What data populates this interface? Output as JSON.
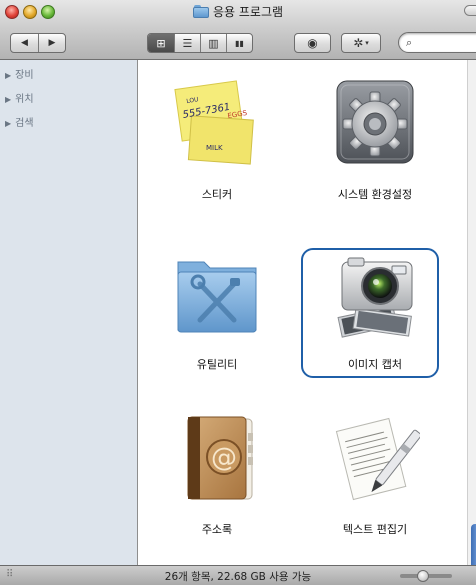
{
  "window": {
    "title": "응용 프로그램"
  },
  "toolbar": {
    "nav_back_icon": "◀",
    "nav_forward_icon": "▶",
    "view_icons": [
      "⊞",
      "☰",
      "▥",
      "▮▮"
    ],
    "quicklook_icon": "◉",
    "action_icon": "✲",
    "action_caret": "▾",
    "search_placeholder": "",
    "search_icon": "⌕"
  },
  "sidebar": {
    "items": [
      {
        "label": "장비"
      },
      {
        "label": "위치"
      },
      {
        "label": "검색"
      }
    ],
    "disclosure_icon": "▶"
  },
  "apps": [
    {
      "label": "스티커",
      "icon": "stickies-icon",
      "note_lines": [
        "LOU",
        "555-7361",
        "EGGS",
        "MILK"
      ]
    },
    {
      "label": "시스템 환경설정",
      "icon": "system-preferences-icon"
    },
    {
      "label": "유틸리티",
      "icon": "utilities-folder-icon"
    },
    {
      "label": "이미지 캡처",
      "icon": "image-capture-icon",
      "selected": true
    },
    {
      "label": "주소록",
      "icon": "address-book-icon"
    },
    {
      "label": "텍스트 편집기",
      "icon": "textedit-icon"
    }
  ],
  "status": {
    "text": "26개 항목, 22.68 GB 사용 가능",
    "icon_size_slider": 0.35
  },
  "colors": {
    "selection_ring": "#1f5fa8",
    "sidebar_bg": "#dde4ec",
    "folder_blue": "#7fb2df"
  }
}
